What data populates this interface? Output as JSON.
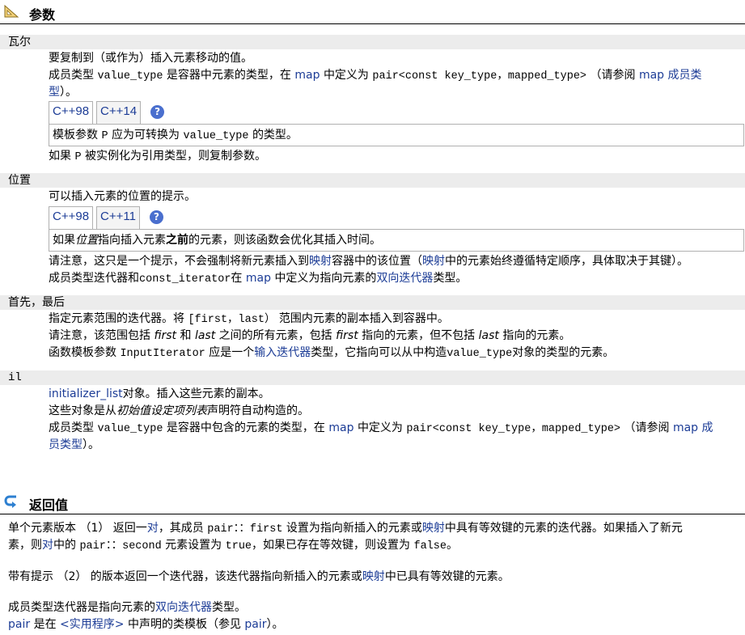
{
  "params_section": {
    "title": "参数",
    "icon": "triangle-ruler-icon"
  },
  "params": {
    "val": {
      "name": "瓦尔",
      "desc": "要复制到（或作为）插入元素移动的值。",
      "member_type_prefix": "成员类型",
      "value_type": "value_type",
      "is_elem_type": "是容器中元素的类型，在",
      "map_link": "map",
      "defined_as": "中定义为",
      "pair_def": "pair<const key_type，mapped_type>",
      "see_prefix": "（请参阅",
      "see_link_a": "map 成员类",
      "see_link_b": "型",
      "see_suffix": "）。",
      "tabs": [
        "C++98",
        "C++14"
      ],
      "box_prefix": "模板参数",
      "box_p": "P",
      "box_mid": "应为可转换为",
      "box_vt": "value_type",
      "box_suffix": "的类型。",
      "after_prefix": "如果",
      "after_p": "P",
      "after_suffix": "被实例化为引用类型，则复制参数。"
    },
    "position": {
      "name": "位置",
      "desc": "可以插入元素的位置的提示。",
      "tabs": [
        "C++98",
        "C++11"
      ],
      "box_a": "如果",
      "box_italic": "位置",
      "box_b": "指向插入元素",
      "box_bold": "之前",
      "box_c": "的元素，则该函数会优化其插入时间。",
      "note_a": "请注意，这只是一个提示，不会强制将新元素插入到",
      "note_link1": "映射",
      "note_b": "容器中的该位置（",
      "note_link2": "映射",
      "note_c": "中的元素始终遵循特定顺序，具体取决于其键）。",
      "iter_a": "成员类型迭代器和",
      "iter_code": "const_iterator",
      "iter_b": "在",
      "iter_map": "map",
      "iter_c": "中定义为指向元素的",
      "iter_link": "双向迭代器",
      "iter_d": "类型。"
    },
    "first_last": {
      "name": "首先，最后",
      "l1_a": "指定元素范围的迭代器。将",
      "l1_code": "[first，last）",
      "l1_b": "范围内元素的副本插入到容器中。",
      "l2_a": "请注意，该范围包括",
      "l2_first": "first",
      "l2_b": "和",
      "l2_last": "last",
      "l2_c": "之间的所有元素，包括",
      "l2_first2": "first",
      "l2_d": "指向的元素，但不包括",
      "l2_last2": "last",
      "l2_e": "指向的元素。",
      "l3_a": "函数模板参数",
      "l3_code": "InputIterator",
      "l3_b": "应是一个",
      "l3_link": "输入迭代器",
      "l3_c": "类型，它指向可以从中构造",
      "l3_vt": "value_type",
      "l3_d": "对象的类型的元素。"
    },
    "il": {
      "name": "il",
      "l1_link": "initializer_list",
      "l1_b": "对象。插入这些元素的副本。",
      "l2_a": "这些对象是从",
      "l2_italic": "初始值设定项列表",
      "l2_b": "声明符自动构造的。",
      "l3_a": "成员类型",
      "l3_vt": "value_type",
      "l3_b": "是容器中包含的元素的类型，在",
      "l3_map": "map",
      "l3_c": "中定义为",
      "l3_pair": "pair<const key_type，mapped_type>",
      "l3_d": "（请参阅",
      "l3_link_a": "map 成",
      "l3_link_b": "员类型",
      "l3_e": "）。"
    }
  },
  "return_section": {
    "title": "返回值",
    "icon": "return-arrow-icon",
    "p1_a": "单个元素版本 （1） 返回一",
    "p1_link1": "对",
    "p1_b": "，其成员",
    "p1_code1": "pair：：first",
    "p1_c": "设置为指向新插入的元素或",
    "p1_link2": "映射",
    "p1_d": "中具有等效键的元素的迭代器。如果插入了新元",
    "p1_e": "素，则",
    "p1_link3": "对",
    "p1_f": "中的",
    "p1_code2": "pair：：second",
    "p1_g": "元素设置为",
    "p1_true": "true",
    "p1_h": "，如果已存在等效键，则设置为",
    "p1_false": "false",
    "p1_i": "。",
    "p2_a": "带有提示 （2） 的版本返回一个迭代器，该迭代器指向新插入的元素或",
    "p2_link": "映射",
    "p2_b": "中已具有等效键的元素。",
    "p3_a": "成员类型迭代器是指向元素的",
    "p3_link": "双向迭代器",
    "p3_b": "类型。",
    "p4_link1": "pair",
    "p4_a": "是在",
    "p4_link2": "<实用程序>",
    "p4_b": "中声明的类模板（参见",
    "p4_link3": "pair",
    "p4_c": "）。"
  },
  "colors": {
    "link": "#1c3c96",
    "param_bg": "#ececec",
    "help_icon": "#4a6fce"
  }
}
